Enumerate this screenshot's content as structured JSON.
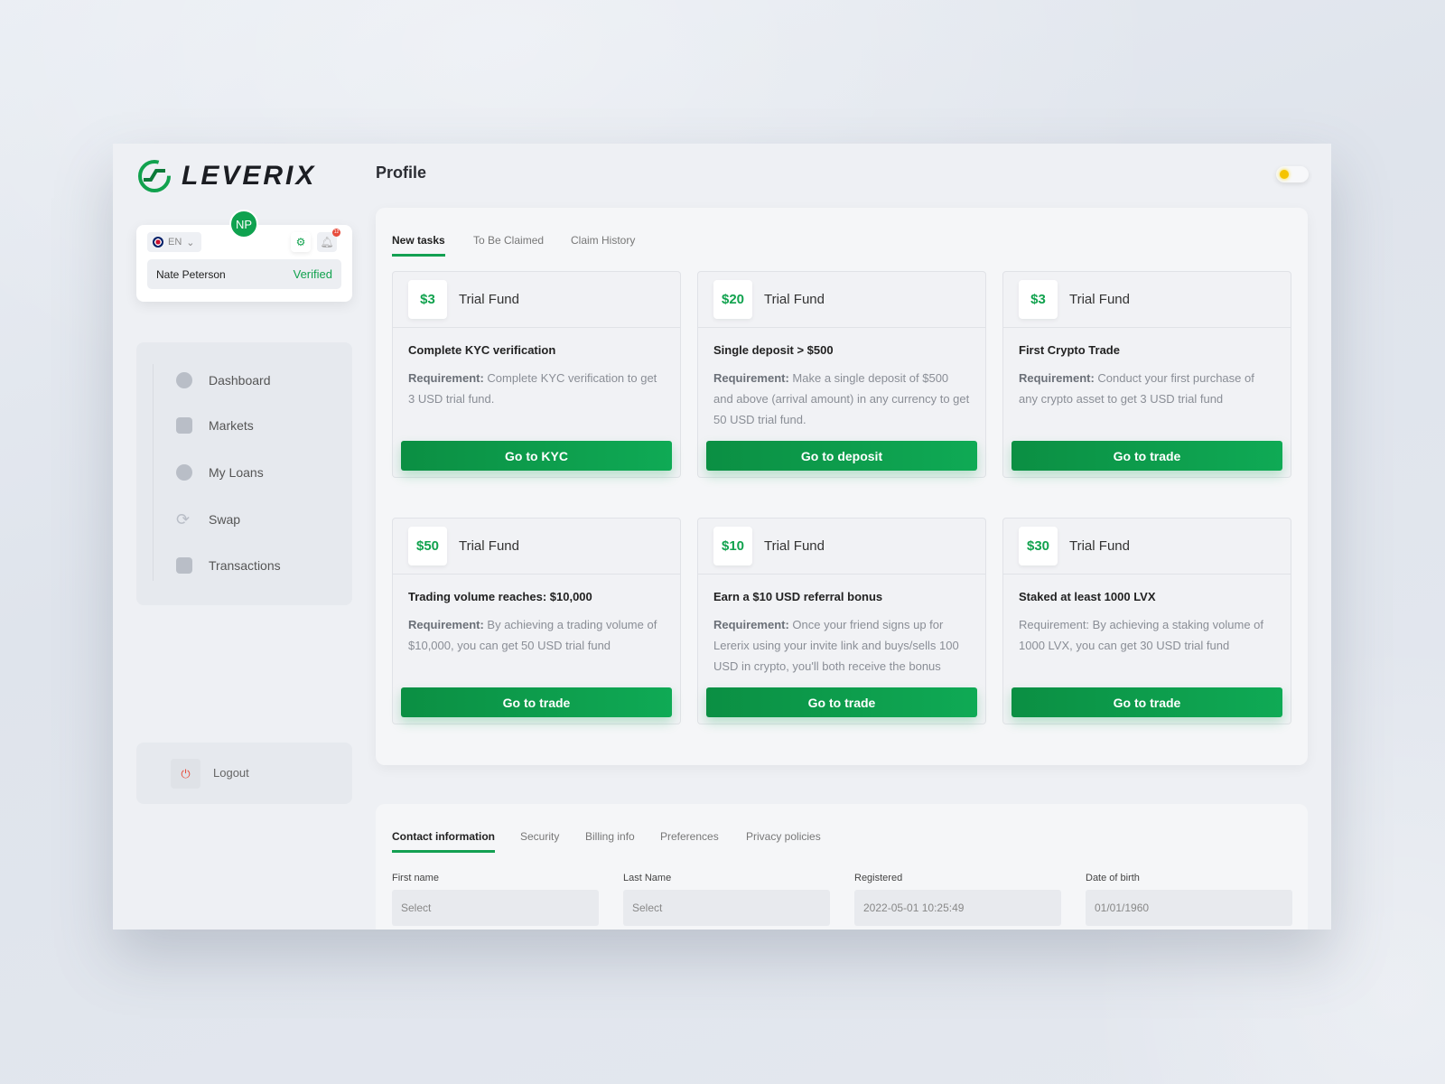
{
  "brand": {
    "name": "LEVERIX"
  },
  "header": {
    "title": "Profile",
    "theme_toggle": "light"
  },
  "user": {
    "initials": "NP",
    "name": "Nate Peterson",
    "status": "Verified",
    "language": "EN",
    "notifications": "12"
  },
  "sidebar": {
    "items": [
      {
        "label": "Dashboard",
        "icon": "pie-chart-icon"
      },
      {
        "label": "Markets",
        "icon": "bank-icon"
      },
      {
        "label": "My Loans",
        "icon": "loan-icon"
      },
      {
        "label": "Swap",
        "icon": "swap-icon"
      },
      {
        "label": "Transactions",
        "icon": "list-icon"
      }
    ],
    "logout": "Logout"
  },
  "tasks": {
    "tabs": [
      "New tasks",
      "To Be Claimed",
      "Claim History"
    ],
    "fund_label": "Trial Fund",
    "req_label": "Requirement:",
    "cards": [
      {
        "amount": "$3",
        "title": "Complete KYC verification",
        "req": "Complete KYC verification to get 3 USD trial fund.",
        "button": "Go to KYC",
        "bold_req": true
      },
      {
        "amount": "$20",
        "title": "Single deposit > $500",
        "req": "Make a single deposit of $500 and above (arrival amount) in any currency to get 50 USD trial fund.",
        "button": "Go to deposit",
        "bold_req": true
      },
      {
        "amount": "$3",
        "title": "First Crypto Trade",
        "req": "Conduct your first purchase of any crypto asset to get 3 USD trial fund",
        "button": "Go to trade",
        "bold_req": true
      },
      {
        "amount": "$50",
        "title": "Trading volume reaches: $10,000",
        "req": "By achieving a trading volume of $10,000, you can get 50 USD trial fund",
        "button": "Go to trade",
        "bold_req": true
      },
      {
        "amount": "$10",
        "title": "Earn a $10 USD referral bonus",
        "req": "Once your friend signs up for Lererix using your invite link and buys/sells 100 USD in crypto, you'll both receive the bonus",
        "button": "Go to trade",
        "bold_req": true
      },
      {
        "amount": "$30",
        "title": "Staked at least 1000 LVX",
        "req": "By achieving a staking volume of 1000 LVX, you can get 30 USD trial fund",
        "button": "Go to trade",
        "bold_req": false
      }
    ]
  },
  "profile": {
    "tabs": [
      "Contact information",
      "Security",
      "Billing info",
      "Preferences",
      "Privacy policies"
    ],
    "fields": [
      {
        "label": "First name",
        "value": "Select"
      },
      {
        "label": "Last Name",
        "value": "Select"
      },
      {
        "label": "Registered",
        "value": "2022-05-01 10:25:49"
      },
      {
        "label": "Date of birth",
        "value": "01/01/1960"
      }
    ]
  },
  "colors": {
    "accent": "#11a24e",
    "danger": "#e74c3c"
  }
}
